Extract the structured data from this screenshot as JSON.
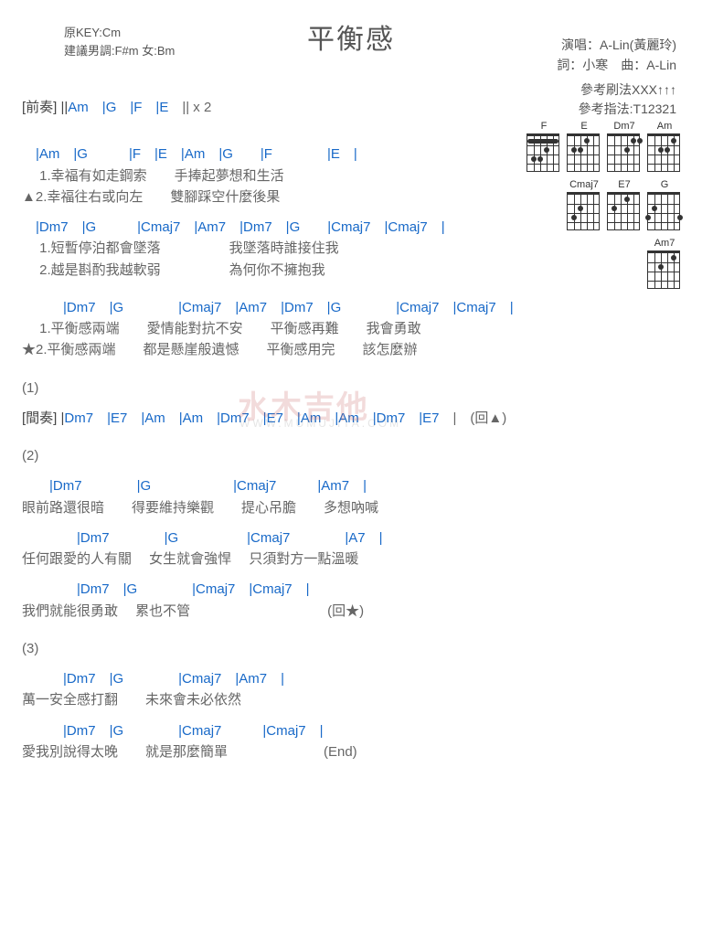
{
  "title": "平衡感",
  "meta_left": {
    "l1": "原KEY:Cm",
    "l2": "建議男調:F#m 女:Bm"
  },
  "meta_right": {
    "l1": "演唱：A-Lin(黃麗玲)",
    "l2": "詞：小寒　曲：A-Lin"
  },
  "ref_right": {
    "l1": "參考刷法XXX↑↑↑",
    "l2": "參考指法:T12321"
  },
  "intro": {
    "label": "[前奏] ||",
    "chords": "Am　|G　|F　|E　",
    "tail": "|| x 2"
  },
  "v1": {
    "c1": "　|Am　|G　　　|F　|E　|Am　|G　　|F　　　　|E　|",
    "l1a": "　 1.幸福有如走鋼索　　手捧起夢想和生活",
    "l1b": "▲2.幸福往右或向左　　雙腳踩空什麼後果",
    "c2": "　|Dm7　|G　　　|Cmaj7　|Am7　|Dm7　|G　　|Cmaj7　|Cmaj7　|",
    "l2a": "　 1.短暫停泊都會墜落　　　　　我墜落時誰接住我",
    "l2b": "　 2.越是斟酌我越軟弱　　　　　為何你不擁抱我"
  },
  "chorus": {
    "c1": "　　　|Dm7　|G　　　　|Cmaj7　|Am7　|Dm7　|G　　　　|Cmaj7　|Cmaj7　|",
    "l1a": "　 1.平衡感兩端　　愛情能對抗不安　　平衡感再難　　我會勇敢",
    "l1b": "★2.平衡感兩端　　都是懸崖般遺憾　　平衡感用完　　該怎麼辦"
  },
  "sec1": {
    "num": "(1)",
    "label": "[間奏] |",
    "chords": "Dm7　|E7　|Am　|Am　|Dm7　|E7　|Am　|Am　|Dm7　|E7　",
    "tail": "|　(回▲)"
  },
  "sec2": {
    "num": "(2)",
    "c1": "　　|Dm7　　　　|G　　　　　　|Cmaj7　　　|Am7　|",
    "l1": "眼前路還很暗　　得要維持樂觀　　提心吊膽　　多想吶喊",
    "c2": "　　　　|Dm7　　　　|G　　　　　|Cmaj7　　　　|A7　|",
    "l2": "任何跟愛的人有關　 女生就會強悍　 只須對方一點溫暖",
    "c3": "　　　　|Dm7　|G　　　　|Cmaj7　|Cmaj7　|",
    "l3": "我們就能很勇敢　 累也不管　　　　　　　　　　(回★)"
  },
  "sec3": {
    "num": "(3)",
    "c1": "　　　|Dm7　|G　　　　|Cmaj7　|Am7　|",
    "l1": "萬一安全感打翻　　未來會未必依然",
    "c2": "　　　|Dm7　|G　　　　|Cmaj7　　　|Cmaj7　|",
    "l2": "愛我別說得太晚　　就是那麼簡單　　　　　　　(End)"
  },
  "diagrams": {
    "r1": [
      "F",
      "E",
      "Dm7",
      "Am"
    ],
    "r2": [
      "Cmaj7",
      "E7",
      "G"
    ],
    "r3": [
      "Am7"
    ]
  },
  "watermark": "水木吉他",
  "watermark_sub": "WWW.MUMUJITA.COM"
}
